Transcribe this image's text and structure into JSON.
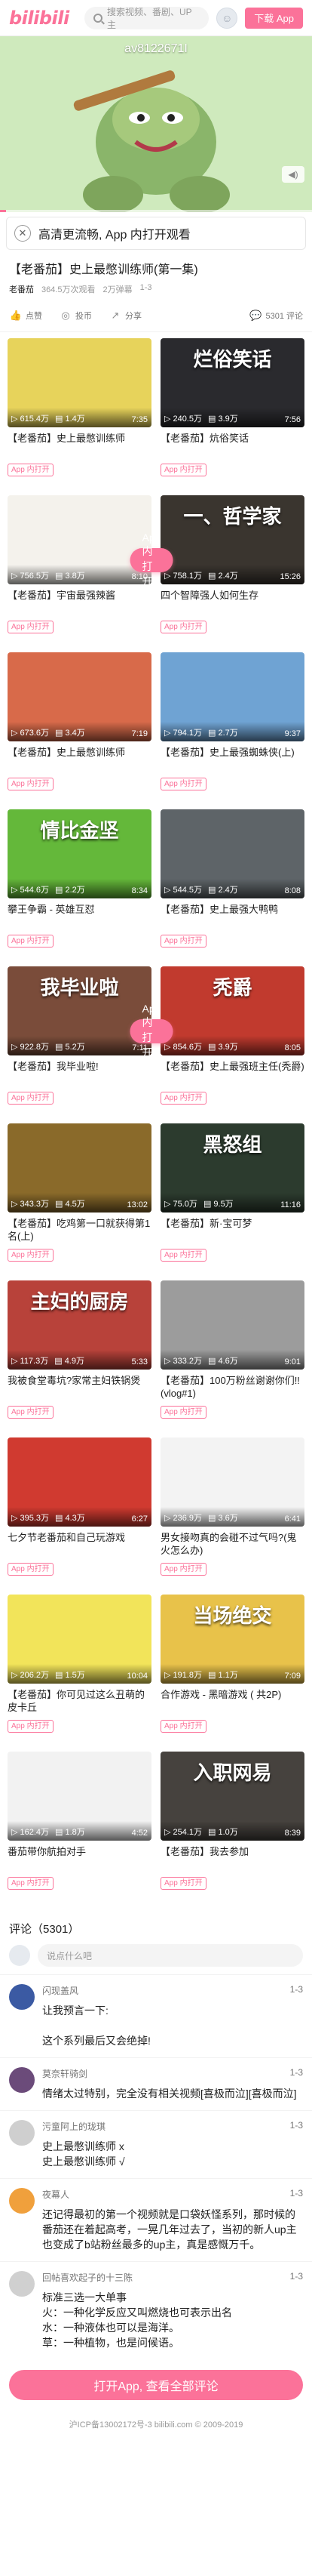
{
  "header": {
    "logo": "bilibili",
    "search_placeholder": "搜索视频、番剧、UP主",
    "download_label": "下载 App"
  },
  "player": {
    "watermark": "av8122671I",
    "smooth_bar_text": "高清更流畅, App 内打开观看",
    "progress_fraction": 0.02
  },
  "video": {
    "title": "【老番茄】史上最憋训练师(第一集)",
    "uploader": "老番茄",
    "views": "364.5万次观看",
    "danmaku": "2万弹幕",
    "date": "1-3",
    "actions": [
      {
        "icon": "thumbs-up-icon",
        "label": "点赞"
      },
      {
        "icon": "coin-icon",
        "label": "投币"
      },
      {
        "icon": "share-icon",
        "label": "分享"
      }
    ],
    "comment_count_label": "5301 评论"
  },
  "open_in_app": "App内打开",
  "app_tag": "App 内打开",
  "videos": [
    {
      "title": "【老番茄】史上最憋训练师",
      "views": "615.4万",
      "danmaku": "1.4万",
      "duration": "7:35",
      "headline": "",
      "bg": "#e7d35b"
    },
    {
      "title": "【老番茄】炕俗笑话",
      "views": "240.5万",
      "danmaku": "3.9万",
      "duration": "7:56",
      "headline": "烂俗笑话",
      "bg": "#2a2a2e"
    },
    {
      "title": "【老番茄】宇宙最强辣酱",
      "views": "756.5万",
      "danmaku": "3.8万",
      "duration": "8:10",
      "headline": "",
      "bg": "#f4f2ec"
    },
    {
      "title": "四个智障强人如何生存",
      "views": "758.1万",
      "danmaku": "2.4万",
      "duration": "15:26",
      "headline": "一、哲学家",
      "bg": "#3a352f"
    },
    {
      "title": "【老番茄】史上最憋训练师",
      "views": "673.6万",
      "danmaku": "3.4万",
      "duration": "7:19",
      "headline": "",
      "bg": "#d86a4a"
    },
    {
      "title": "【老番茄】史上最强蜘蛛侠(上)",
      "views": "794.1万",
      "danmaku": "2.7万",
      "duration": "9:37",
      "headline": "",
      "bg": "#6fa3d3"
    },
    {
      "title": "攀王争霸 - 英雄互怼",
      "views": "544.6万",
      "danmaku": "2.2万",
      "duration": "8:34",
      "headline": "情比金坚",
      "bg": "#64b83a"
    },
    {
      "title": "【老番茄】史上最强大鸭鸭",
      "views": "544.5万",
      "danmaku": "2.4万",
      "duration": "8:08",
      "headline": "",
      "bg": "#5e6468"
    },
    {
      "title": "【老番茄】我毕业啦!",
      "views": "922.8万",
      "danmaku": "5.2万",
      "duration": "7:11",
      "headline": "我毕业啦",
      "bg": "#7a4c3a"
    },
    {
      "title": "【老番茄】史上最强班主任(秃爵)",
      "views": "854.6万",
      "danmaku": "3.9万",
      "duration": "8:05",
      "headline": "秃爵",
      "bg": "#c13a2e"
    },
    {
      "title": "【老番茄】吃鸡第一口就获得第1名(上)",
      "views": "343.3万",
      "danmaku": "4.5万",
      "duration": "13:02",
      "headline": "",
      "bg": "#8a6a2a"
    },
    {
      "title": "【老番茄】新·宝可梦",
      "views": "75.0万",
      "danmaku": "9.5万",
      "duration": "11:16",
      "headline": "黑怒组",
      "bg": "#2c3b2e"
    },
    {
      "title": "我被食堂毒坑?家常主妇铁锅煲",
      "views": "117.3万",
      "danmaku": "4.9万",
      "duration": "5:33",
      "headline": "主妇的厨房",
      "bg": "#b8423a"
    },
    {
      "title": "【老番茄】100万粉丝谢谢你们!! (vlog#1)",
      "views": "333.2万",
      "danmaku": "4.6万",
      "duration": "9:01",
      "headline": "",
      "bg": "#9c9c9c"
    },
    {
      "title": "七夕节老番茄和自己玩游戏",
      "views": "395.3万",
      "danmaku": "4.3万",
      "duration": "6:27",
      "headline": "",
      "bg": "#d03a30"
    },
    {
      "title": "男女接吻真的会碰不过气吗?(鬼火怎么办)",
      "views": "236.9万",
      "danmaku": "3.6万",
      "duration": "6:41",
      "headline": "",
      "bg": "#f3f3f3"
    },
    {
      "title": "【老番茄】你可见过这么丑萌的皮卡丘",
      "views": "206.2万",
      "danmaku": "1.5万",
      "duration": "10:04",
      "headline": "",
      "bg": "#f2e45a"
    },
    {
      "title": "合作游戏 - 黑暗游戏 ( 共2P)",
      "views": "191.8万",
      "danmaku": "1.1万",
      "duration": "7:09",
      "headline": "当场绝交",
      "bg": "#e8c24a"
    },
    {
      "title": "番茄带你航拍对手",
      "views": "162.4万",
      "danmaku": "1.8万",
      "duration": "4:52",
      "headline": "",
      "bg": "#f2f2f2"
    },
    {
      "title": "【老番茄】我去参加",
      "views": "254.1万",
      "danmaku": "1.0万",
      "duration": "8:39",
      "headline": "入职网易",
      "bg": "#46423e"
    }
  ],
  "comments": {
    "title": "评论",
    "count": "5301",
    "input_placeholder": "说点什么吧",
    "items": [
      {
        "user": "闪现盖风",
        "date": "1-3",
        "text": "让我预言一下:\n\n这个系列最后又会绝掉!",
        "avatar_color": "#3b5aa3"
      },
      {
        "user": "莫奈轩骑剑",
        "date": "1-3",
        "text": "情绪太过特别，完全没有相关视频[喜极而泣][喜极而泣]",
        "avatar_color": "#6b4b7a"
      },
      {
        "user": "污童阿上的珑琪",
        "date": "1-3",
        "text": "史上最憋训练师 x\n史上最憋训练师 √",
        "avatar_color": "#cfcfcf"
      },
      {
        "user": "夜幕人",
        "date": "1-3",
        "text": "还记得最初的第一个视频就是口袋妖怪系列，那时候的番茄还在着起高考，一晃几年过去了，当初的新人up主也变成了b站粉丝最多的up主，真是感慨万千。",
        "avatar_color": "#f0a03c"
      },
      {
        "user": "回帖喜欢起子的十三陈",
        "date": "1-3",
        "text": "标准三选一大单事\n火：一种化学反应又叫燃烧也可表示出名\n水：一种液体也可以是海洋。\n草：一种植物，也是问候语。",
        "avatar_color": "#d0d0d0"
      }
    ]
  },
  "open_all_label": "打开App, 查看全部评论",
  "footer": "沪ICP备13002172号-3 bilibili.com © 2009-2019",
  "colors": {
    "brand": "#fb7299",
    "text": "#212121",
    "muted": "#999999"
  }
}
